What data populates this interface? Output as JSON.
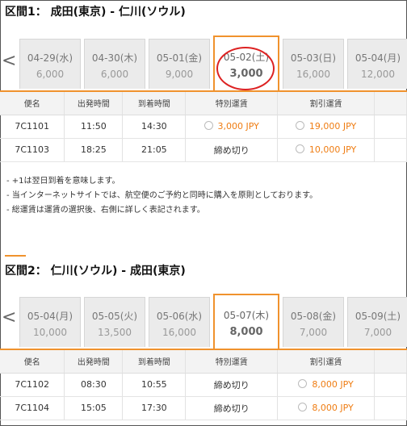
{
  "segment1": {
    "title": "区間1： 成田(東京) - 仁川(ソウル)",
    "nav_left": "<",
    "dates": [
      {
        "date": "04-29(水)",
        "price": "6,000"
      },
      {
        "date": "04-30(木)",
        "price": "6,000"
      },
      {
        "date": "05-01(金)",
        "price": "9,000"
      },
      {
        "date": "05-02(土)",
        "price": "3,000"
      },
      {
        "date": "05-03(日)",
        "price": "16,000"
      },
      {
        "date": "05-04(月)",
        "price": "12,000"
      }
    ],
    "selected_index": 3,
    "headers": [
      "便名",
      "出発時間",
      "到着時間",
      "特別運賃",
      "割引運賃"
    ],
    "rows": [
      {
        "flight": "7C1101",
        "dep": "11:50",
        "arr": "14:30",
        "special": "3,000 JPY",
        "discount": "19,000 JPY"
      },
      {
        "flight": "7C1103",
        "dep": "18:25",
        "arr": "21:05",
        "special": "締め切り",
        "discount": "10,000 JPY"
      }
    ]
  },
  "notes": [
    "- +1は翌日到着を意味します。",
    "- 当インターネットサイトでは、航空便のご予約と同時に購入を原則としております。",
    "- 総運賃は運賃の選択後、右側に詳しく表記されます。"
  ],
  "segment2": {
    "title": "区間2： 仁川(ソウル) - 成田(東京)",
    "nav_left": "<",
    "dates": [
      {
        "date": "05-04(月)",
        "price": "10,000"
      },
      {
        "date": "05-05(火)",
        "price": "13,500"
      },
      {
        "date": "05-06(水)",
        "price": "16,000"
      },
      {
        "date": "05-07(木)",
        "price": "8,000"
      },
      {
        "date": "05-08(金)",
        "price": "7,000"
      },
      {
        "date": "05-09(土)",
        "price": "7,000"
      }
    ],
    "selected_index": 3,
    "headers": [
      "便名",
      "出発時間",
      "到着時間",
      "特別運賃",
      "割引運賃"
    ],
    "rows": [
      {
        "flight": "7C1102",
        "dep": "08:30",
        "arr": "10:55",
        "special": "締め切り",
        "discount": "8,000 JPY"
      },
      {
        "flight": "7C1104",
        "dep": "15:05",
        "arr": "17:30",
        "special": "締め切り",
        "discount": "8,000 JPY"
      }
    ]
  },
  "colors": {
    "accent": "#f0922d",
    "price_text": "#ef7d13",
    "annotation": "#dd2222"
  }
}
